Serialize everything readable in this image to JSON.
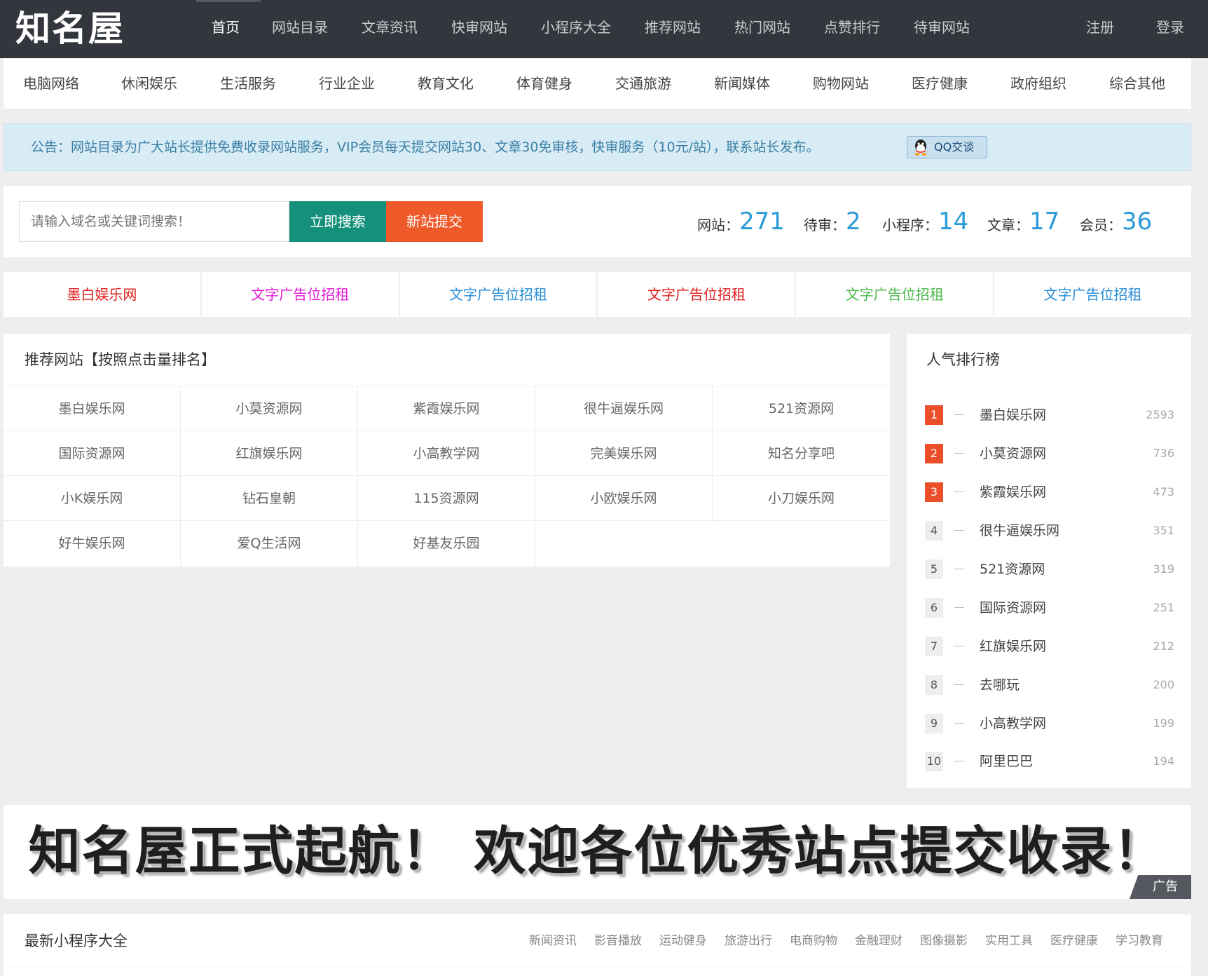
{
  "header": {
    "logo": "知名屋",
    "nav": [
      "首页",
      "网站目录",
      "文章资讯",
      "快审网站",
      "小程序大全",
      "推荐网站",
      "热门网站",
      "点赞排行",
      "待审网站"
    ],
    "register": "注册",
    "login": "登录"
  },
  "categories": [
    "电脑网络",
    "休闲娱乐",
    "生活服务",
    "行业企业",
    "教育文化",
    "体育健身",
    "交通旅游",
    "新闻媒体",
    "购物网站",
    "医疗健康",
    "政府组织",
    "综合其他"
  ],
  "notice": {
    "text": "公告：网站目录为广大站长提供免费收录网站服务，VIP会员每天提交网站30、文章30免审核，快审服务（10元/站），联系站长发布。",
    "qq_label": "QQ交谈"
  },
  "search": {
    "placeholder": "请输入域名或关键词搜索！",
    "search_btn": "立即搜索",
    "submit_btn": "新站提交"
  },
  "stats": [
    {
      "label": "网站：",
      "value": "271"
    },
    {
      "label": "待审：",
      "value": "2"
    },
    {
      "label": "小程序：",
      "value": "14"
    },
    {
      "label": "文章：",
      "value": "17"
    },
    {
      "label": "会员：",
      "value": "36"
    }
  ],
  "ads": [
    {
      "text": "墨白娱乐网",
      "color": "#e02020"
    },
    {
      "text": "文字广告位招租",
      "color": "#e21ad8"
    },
    {
      "text": "文字广告位招租",
      "color": "#2a8fd8"
    },
    {
      "text": "文字广告位招租",
      "color": "#e02020"
    },
    {
      "text": "文字广告位招租",
      "color": "#4bb84b"
    },
    {
      "text": "文字广告位招租",
      "color": "#2a8fd8"
    }
  ],
  "recommended": {
    "title": "推荐网站【按照点击量排名】",
    "sites": [
      "墨白娱乐网",
      "小莫资源网",
      "紫霞娱乐网",
      "很牛逼娱乐网",
      "521资源网",
      "国际资源网",
      "红旗娱乐网",
      "小高教学网",
      "完美娱乐网",
      "知名分享吧",
      "小K娱乐网",
      "钻石皇朝",
      "115资源网",
      "小欧娱乐网",
      "小刀娱乐网",
      "好牛娱乐网",
      "爱Q生活网",
      "好基友乐园"
    ]
  },
  "ranking": {
    "title": "人气排行榜",
    "items": [
      {
        "rank": "1",
        "name": "墨白娱乐网",
        "count": "2593"
      },
      {
        "rank": "2",
        "name": "小莫资源网",
        "count": "736"
      },
      {
        "rank": "3",
        "name": "紫霞娱乐网",
        "count": "473"
      },
      {
        "rank": "4",
        "name": "很牛逼娱乐网",
        "count": "351"
      },
      {
        "rank": "5",
        "name": "521资源网",
        "count": "319"
      },
      {
        "rank": "6",
        "name": "国际资源网",
        "count": "251"
      },
      {
        "rank": "7",
        "name": "红旗娱乐网",
        "count": "212"
      },
      {
        "rank": "8",
        "name": "去哪玩",
        "count": "200"
      },
      {
        "rank": "9",
        "name": "小高教学网",
        "count": "199"
      },
      {
        "rank": "10",
        "name": "阿里巴巴",
        "count": "194"
      }
    ]
  },
  "banner": {
    "text": "知名屋正式起航！ 欢迎各位优秀站点提交收录！",
    "ad_tag": "广告"
  },
  "mini": {
    "title": "最新小程序大全",
    "tabs": [
      "新闻资讯",
      "影音播放",
      "运动健身",
      "旅游出行",
      "电商购物",
      "金融理财",
      "图像摄影",
      "实用工具",
      "医疗健康",
      "学习教育"
    ]
  },
  "colors": {
    "topbar": "#33373d",
    "accent_teal": "#14907b",
    "accent_orange": "#ee5a2a",
    "stat_blue": "#2a9ad8",
    "hot_rank": "#ea4f2a"
  }
}
